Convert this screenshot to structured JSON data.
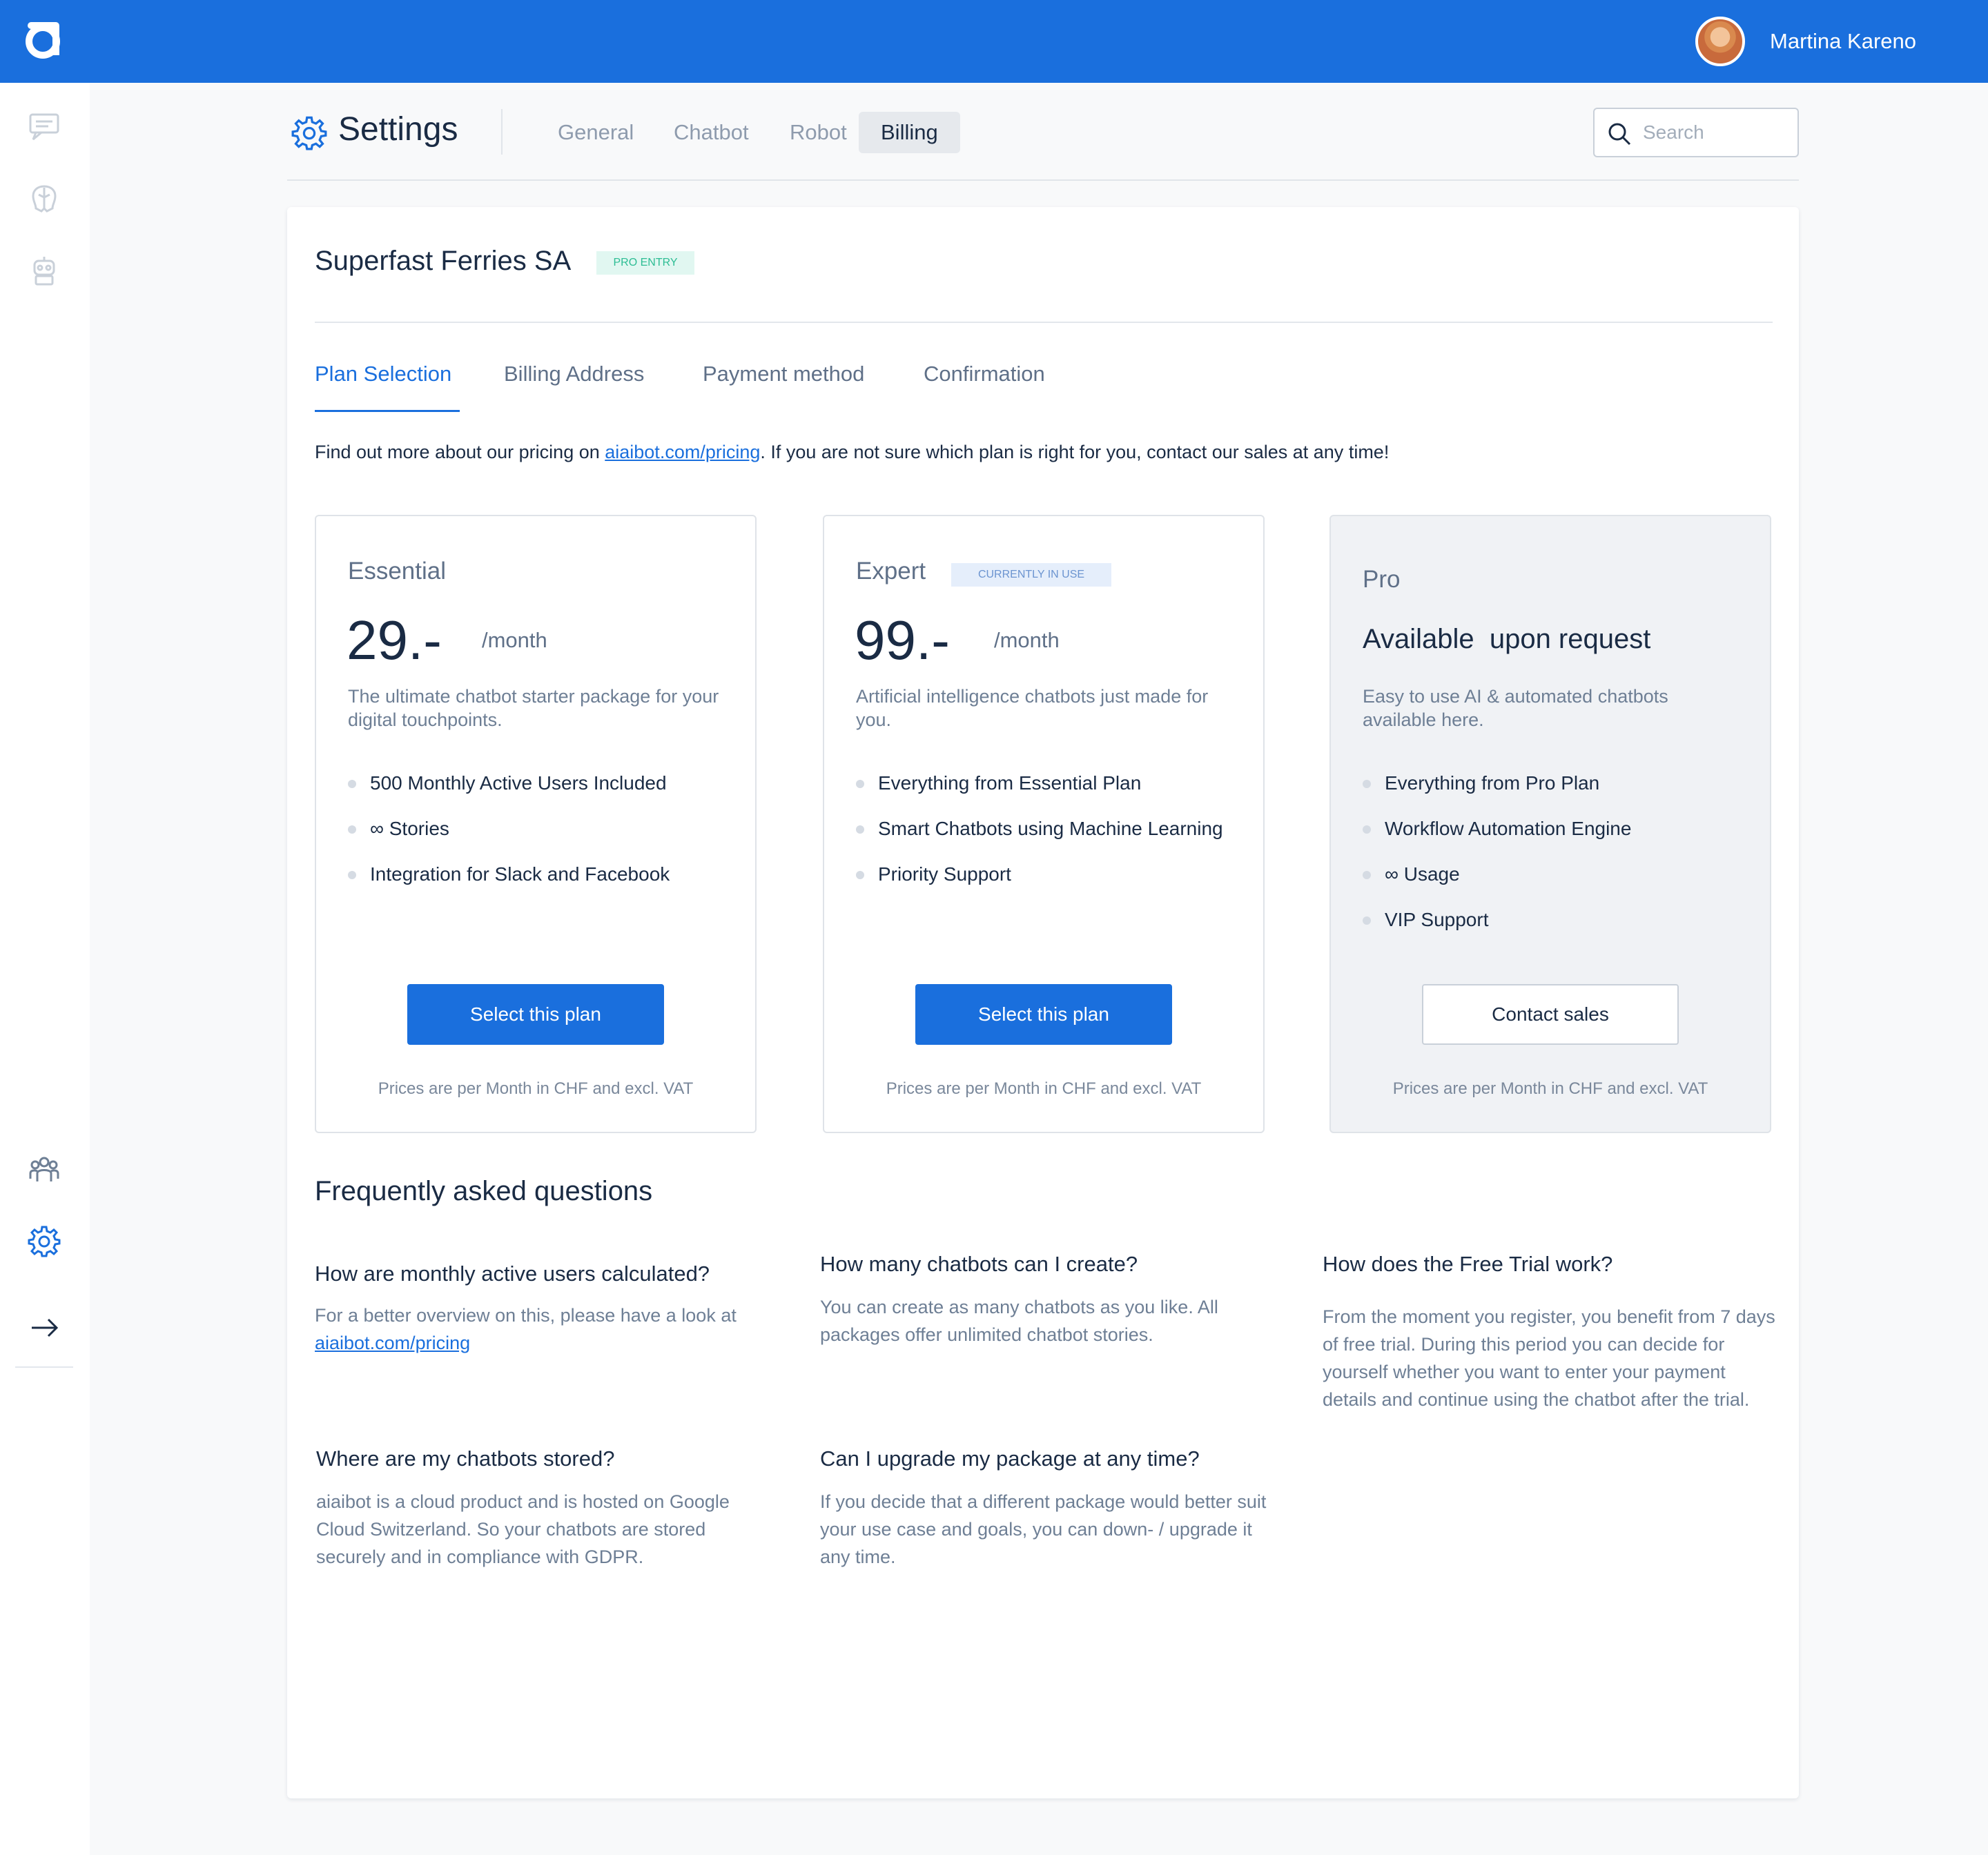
{
  "user": {
    "name": "Martina Kareno"
  },
  "header": {
    "title": "Settings",
    "tabs": [
      {
        "label": "General"
      },
      {
        "label": "Chatbot"
      },
      {
        "label": "Robot"
      },
      {
        "label": "Billing",
        "active": true
      }
    ],
    "search_placeholder": "Search"
  },
  "company": {
    "name": "Superfast Ferries SA",
    "badge": "PRO ENTRY"
  },
  "steps": [
    {
      "label": "Plan Selection",
      "active": true
    },
    {
      "label": "Billing Address"
    },
    {
      "label": "Payment method"
    },
    {
      "label": "Confirmation"
    }
  ],
  "intro": {
    "before": "Find out more about our pricing on ",
    "link": "aiaibot.com/pricing",
    "after": ". If you are not sure which plan is right for you, contact our sales at any time!"
  },
  "plans": [
    {
      "name": "Essential",
      "price": "29.-",
      "period": "/month",
      "description": "The ultimate chatbot starter package for your digital touchpoints.",
      "features": [
        "500 Monthly Active Users Included",
        "∞ Stories",
        "Integration for Slack and Facebook"
      ],
      "button": "Select this plan",
      "note": "Prices are per Month in CHF and excl. VAT"
    },
    {
      "name": "Expert",
      "badge": "CURRENTLY IN USE",
      "price": "99.-",
      "period": "/month",
      "description": "Artificial intelligence chatbots just made for you.",
      "features": [
        "Everything from Essential Plan",
        "Smart Chatbots using Machine Learning",
        "Priority Support"
      ],
      "button": "Select this plan",
      "note": "Prices are per Month in CHF and excl. VAT"
    },
    {
      "name": "Pro",
      "price_text": "Available  upon request",
      "description": "Easy to use AI & automated chatbots available here.",
      "features": [
        "Everything from Pro Plan",
        "Workflow Automation Engine",
        "∞ Usage",
        "VIP Support"
      ],
      "button": "Contact sales",
      "note": "Prices are per Month in CHF and excl. VAT"
    }
  ],
  "faq": {
    "title": "Frequently asked questions",
    "items": [
      {
        "q": "How are monthly active users calculated?",
        "a": "For a better overview on this, please have a look at",
        "link": "aiaibot.com/pricing"
      },
      {
        "q": "How many chatbots can I create?",
        "a": "You can create as many chatbots as you like. All packages offer unlimited chatbot stories."
      },
      {
        "q": "How does the Free Trial work?",
        "a": "From the moment you register, you benefit from 7 days of free trial. During this period you can decide for yourself whether you want to enter your payment details and continue using the chatbot after the trial."
      },
      {
        "q": "Where are my chatbots stored?",
        "a": "aiaibot is a cloud product and is hosted on Google Cloud Switzerland. So your chatbots are stored securely and in compliance with GDPR."
      },
      {
        "q": "Can I upgrade my package at any time?",
        "a": "If you decide that a different package would better suit your use case and goals, you can down- / upgrade it any time."
      }
    ]
  },
  "colors": {
    "brand": "#1a6fdd",
    "text": "#1a2b44",
    "muted": "#6e7f95",
    "pro_badge": "#2dbd94"
  },
  "icons": [
    "logo-icon",
    "chat-icon",
    "brain-icon",
    "robot-icon",
    "team-icon",
    "gear-icon",
    "arrow-right-icon",
    "search-icon"
  ]
}
